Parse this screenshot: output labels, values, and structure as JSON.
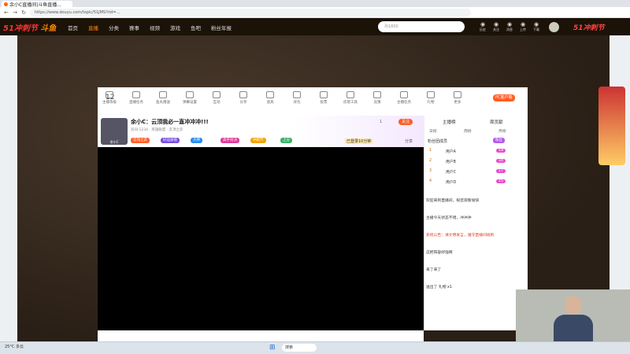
{
  "browser": {
    "tab_title": "余小C直播间|斗鱼直播...",
    "url": "https://www.douyu.com/topic/51JMS?rid=...",
    "nav_back": "←",
    "nav_forward": "→",
    "nav_reload": "↻"
  },
  "site": {
    "logo": "51冲刺节",
    "brand": "斗鱼",
    "nav": [
      "首页",
      "直播",
      "分类",
      "赛事",
      "视频",
      "游戏",
      "鱼吧",
      "粉丝年报"
    ],
    "search_placeholder": "孙1800",
    "banner_right": "51冲刺节",
    "header_icons": [
      {
        "icon": "history-icon",
        "label": "历史"
      },
      {
        "icon": "follow-icon",
        "label": "关注"
      },
      {
        "icon": "message-icon",
        "label": "消息"
      },
      {
        "icon": "upload-icon",
        "label": "上传"
      },
      {
        "icon": "download-icon",
        "label": "下载"
      }
    ]
  },
  "toolbar": {
    "level": "12",
    "items": [
      "主播等级",
      "直播任务",
      "鱼丸赠送",
      "弹幕设置",
      "互动",
      "分享",
      "道具",
      "背包",
      "投票",
      "房管工具",
      "竞猜",
      "主播任务",
      "礼物",
      "更多"
    ],
    "pc_client": "PC客户端"
  },
  "stream": {
    "title": "余小C：云顶我必一直冲冲冲!!!",
    "streamer": "余小C",
    "room_info": "房间:1234 · 英雄联盟 · 云顶之弈",
    "follow_count": "1",
    "follow_label": "关注",
    "tags": [
      "云顶之弈",
      "好运加倍",
      "大神",
      "高手对决",
      "冲刺节",
      "上分"
    ],
    "rank_text": "已登录10分钟",
    "share": "分享"
  },
  "chat": {
    "tab1": "主播榜",
    "tab2": "周贡献",
    "sub_tabs": [
      "日榜",
      "周榜",
      "月榜"
    ],
    "rank_header": "粉丝团成员",
    "rank_badge": "粉丝",
    "ranks": [
      {
        "n": "1",
        "name": "用户A",
        "lv": "19"
      },
      {
        "n": "2",
        "name": "用户B",
        "lv": "18"
      },
      {
        "n": "3",
        "name": "用户C",
        "lv": "17"
      },
      {
        "n": "4",
        "name": "用户D",
        "lv": "15"
      }
    ],
    "lines": [
      "欢迎来到直播间，祝您观看愉快",
      "主播今天状态不错，冲冲冲",
      "系统公告：请文明发言，遵守直播间规则",
      "这把阵容好强啊",
      "来了来了",
      "送出了 礼物 x1"
    ]
  },
  "taskbar": {
    "search": "搜索",
    "weather_temp": "25°C",
    "weather": "多云"
  },
  "colors": {
    "accent": "#ff5d23",
    "header": "#1b1208",
    "video": "#000000"
  }
}
